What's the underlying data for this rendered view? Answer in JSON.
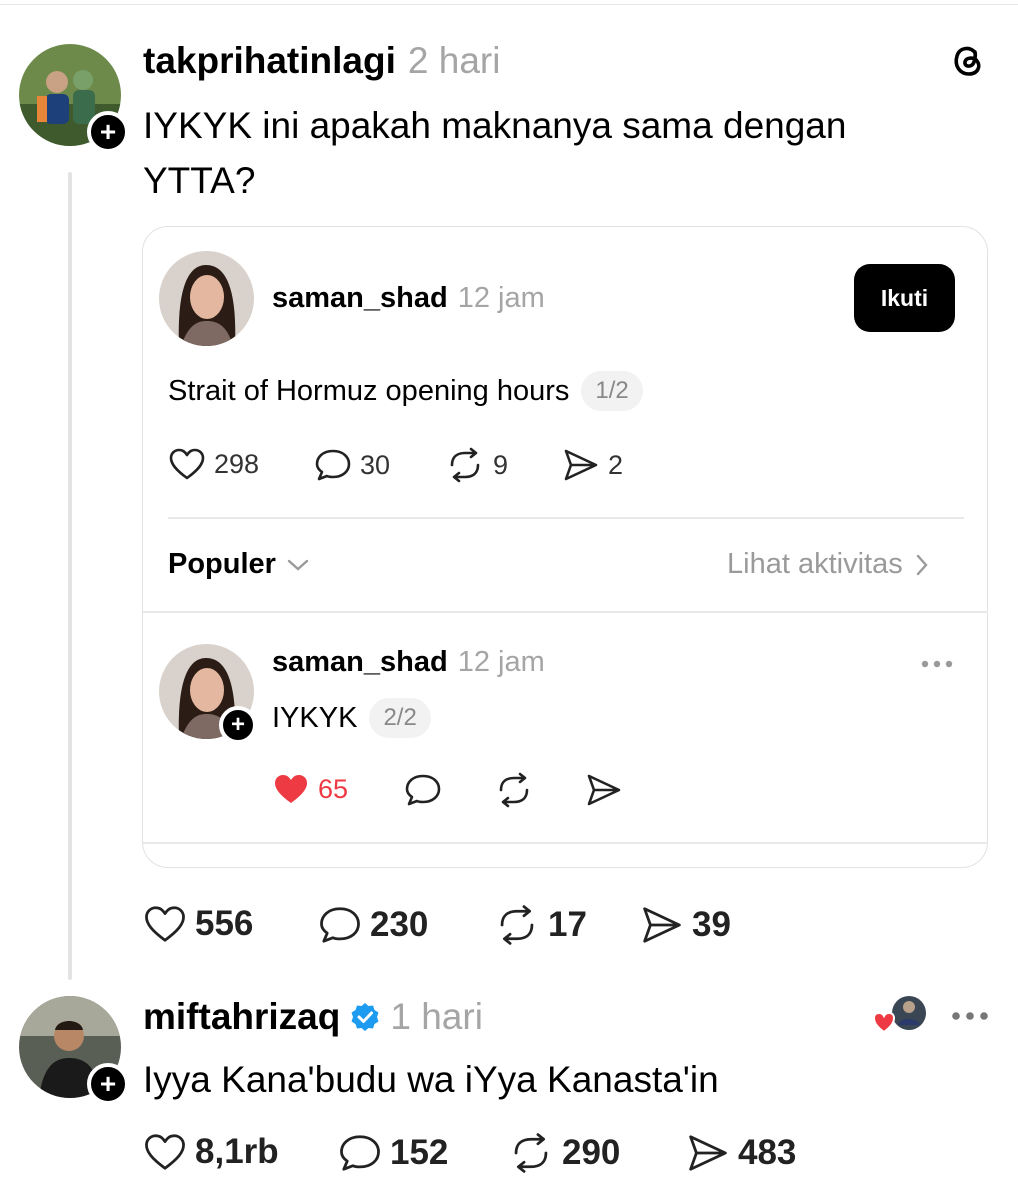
{
  "post": {
    "username": "takprihatinlagi",
    "time": "2 hari",
    "text": "IYKYK ini apakah maknanya sama dengan YTTA?",
    "actions": {
      "likes": "556",
      "replies": "230",
      "reposts": "17",
      "shares": "39"
    },
    "app_icon": "threads-logo-icon"
  },
  "quote": {
    "username": "saman_shad",
    "time": "12 jam",
    "follow_label": "Ikuti",
    "text": "Strait of Hormuz opening hours",
    "counter": "1/2",
    "actions": {
      "likes": "298",
      "replies": "30",
      "reposts": "9",
      "shares": "2"
    },
    "sort_label": "Populer",
    "activity_label": "Lihat aktivitas",
    "reply": {
      "username": "saman_shad",
      "time": "12 jam",
      "text": "IYKYK",
      "counter": "2/2",
      "likes": "65",
      "like_color": "#ee3a43"
    }
  },
  "comment": {
    "username": "miftahrizaq",
    "verified": true,
    "time": "1 hari",
    "text": "Iyya Kana'budu wa iYya Kanasta'in",
    "actions": {
      "likes": "8,1rb",
      "replies": "152",
      "reposts": "290",
      "shares": "483"
    }
  },
  "colors": {
    "verified": "#1d9bf0",
    "heart": "#ee3a43"
  }
}
